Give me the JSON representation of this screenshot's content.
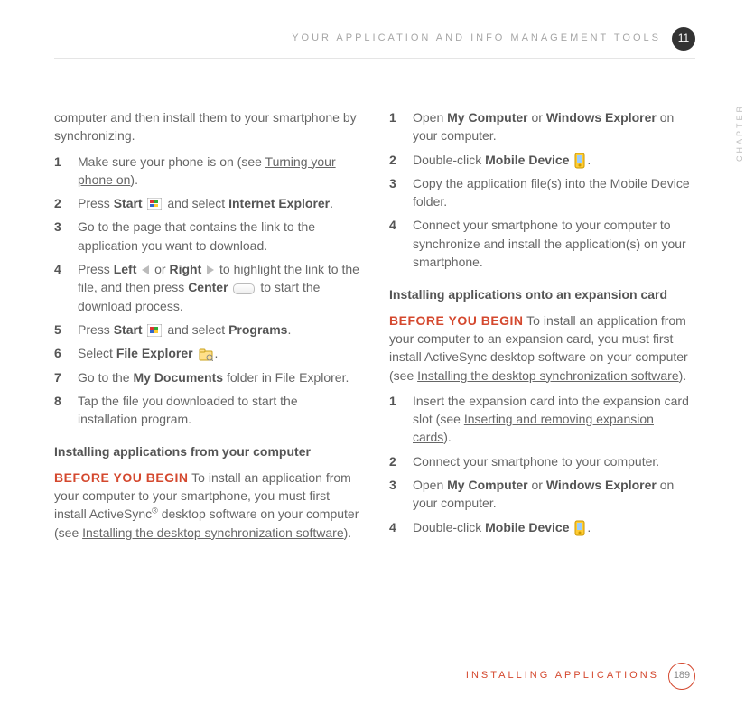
{
  "header": {
    "label": "YOUR APPLICATION AND INFO MANAGEMENT TOOLS",
    "chapter_num": "11",
    "chapter_word": "CHAPTER"
  },
  "left": {
    "intro": "computer and then install them to your smartphone by synchronizing.",
    "steps": [
      {
        "n": "1",
        "pre": "Make sure your phone is on (see ",
        "link": "Turning your phone on",
        "post": ")."
      },
      {
        "n": "2",
        "text_a": "Press ",
        "b1": "Start",
        "icon1": "start",
        "text_b": " and select ",
        "b2": "Internet Explorer",
        "post": "."
      },
      {
        "n": "3",
        "plain": "Go to the page that contains the link to the application you want to download."
      },
      {
        "n": "4",
        "text_a": "Press ",
        "b1": "Left",
        "icon1": "tri-left",
        "text_b": " or ",
        "b2": "Right",
        "icon2": "tri-right",
        "text_c": " to highlight the link to the file, and then press ",
        "b3": "Center",
        "icon3": "center",
        "post": " to start the download process."
      },
      {
        "n": "5",
        "text_a": "Press ",
        "b1": "Start",
        "icon1": "start",
        "text_b": " and select ",
        "b2": "Programs",
        "post": "."
      },
      {
        "n": "6",
        "text_a": "Select ",
        "b1": "File Explorer",
        "icon1": "file-explorer",
        "post": "."
      },
      {
        "n": "7",
        "text_a": "Go to the ",
        "b1": "My Documents",
        "post": " folder in File Explorer."
      },
      {
        "n": "8",
        "plain": "Tap the file you downloaded to start the installation program."
      }
    ],
    "section2_head": "Installing applications from your computer",
    "before_label": "BEFORE YOU BEGIN",
    "before_text_a": "  To install an application from your computer to your smartphone, you must first install ActiveSync",
    "before_sup": "®",
    "before_text_b": " desktop software on your computer (see ",
    "before_link": "Installing the desktop synchronization software",
    "before_post": ")."
  },
  "right": {
    "steps1": [
      {
        "n": "1",
        "text_a": "Open ",
        "b1": "My Computer",
        "text_b": " or ",
        "b2": "Windows Explorer",
        "post": " on your computer."
      },
      {
        "n": "2",
        "text_a": "Double-click ",
        "b1": "Mobile Device",
        "icon1": "mobile-device",
        "post": "."
      },
      {
        "n": "3",
        "plain": "Copy the application file(s) into the Mobile Device folder."
      },
      {
        "n": "4",
        "plain": "Connect your smartphone to your computer to synchronize and install the application(s) on your smartphone."
      }
    ],
    "section_head": "Installing applications onto an expansion card",
    "before_label": "BEFORE YOU BEGIN",
    "before_text_a": "  To install an application from your computer to an expansion card, you must first install ActiveSync desktop software on your computer (see ",
    "before_link": "Installing the desktop synchronization software",
    "before_post": ").",
    "steps2": [
      {
        "n": "1",
        "text_a": "Insert the expansion card into the expansion card slot (see ",
        "link": "Inserting and removing expansion cards",
        "post": ")."
      },
      {
        "n": "2",
        "plain": "Connect your smartphone to your computer."
      },
      {
        "n": "3",
        "text_a": "Open ",
        "b1": "My Computer",
        "text_b": " or ",
        "b2": "Windows Explorer",
        "post": " on your computer."
      },
      {
        "n": "4",
        "text_a": "Double-click ",
        "b1": "Mobile Device",
        "icon1": "mobile-device",
        "post": "."
      }
    ]
  },
  "footer": {
    "label": "INSTALLING APPLICATIONS",
    "page": "189"
  }
}
